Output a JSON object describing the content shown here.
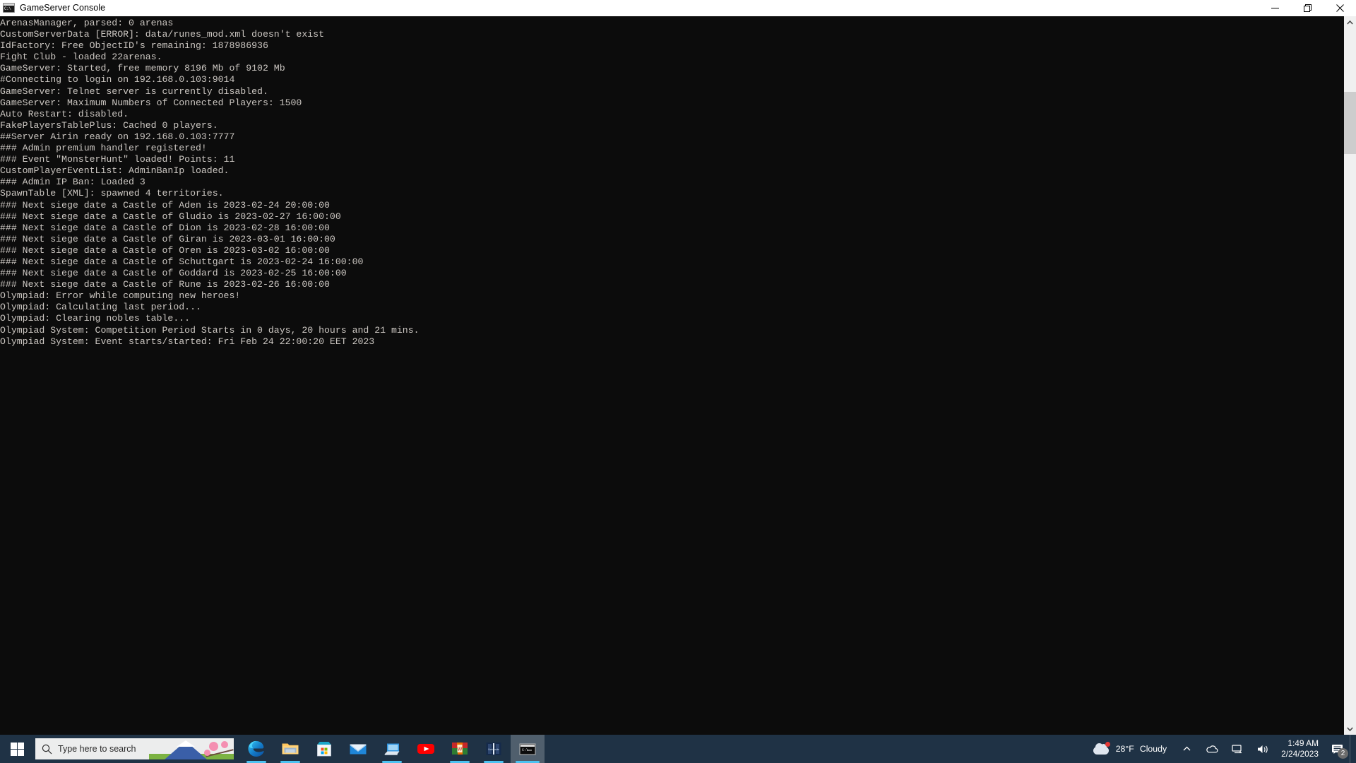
{
  "window": {
    "title": "GameServer Console",
    "icon": "console-icon",
    "controls": {
      "minimize_label": "Minimize",
      "restore_label": "Restore",
      "close_label": "Close"
    }
  },
  "console": {
    "foreground_color": "#ccc7c2",
    "background_color": "#0c0c0c",
    "lines": [
      "ArenasManager, parsed: 0 arenas",
      "CustomServerData [ERROR]: data/runes_mod.xml doesn't exist",
      "IdFactory: Free ObjectID's remaining: 1878986936",
      "Fight Club - loaded 22arenas.",
      "GameServer: Started, free memory 8196 Mb of 9102 Mb",
      "#Connecting to login on 192.168.0.103:9014",
      "GameServer: Telnet server is currently disabled.",
      "GameServer: Maximum Numbers of Connected Players: 1500",
      "Auto Restart: disabled.",
      "FakePlayersTablePlus: Cached 0 players.",
      "##Server Airin ready on 192.168.0.103:7777",
      "### Admin premium handler registered!",
      "### Event \"MonsterHunt\" loaded! Points: 11",
      "CustomPlayerEventList: AdminBanIp loaded.",
      "### Admin IP Ban: Loaded 3",
      "SpawnTable [XML]: spawned 4 territories.",
      "### Next siege date a Castle of Aden is 2023-02-24 20:00:00",
      "### Next siege date a Castle of Gludio is 2023-02-27 16:00:00",
      "### Next siege date a Castle of Dion is 2023-02-28 16:00:00",
      "### Next siege date a Castle of Giran is 2023-03-01 16:00:00",
      "### Next siege date a Castle of Oren is 2023-03-02 16:00:00",
      "### Next siege date a Castle of Schuttgart is 2023-02-24 16:00:00",
      "### Next siege date a Castle of Goddard is 2023-02-25 16:00:00",
      "### Next siege date a Castle of Rune is 2023-02-26 16:00:00",
      "Olympiad: Error while computing new heroes!",
      "Olympiad: Calculating last period...",
      "Olympiad: Clearing nobles table...",
      "Olympiad System: Competition Period Starts in 0 days, 20 hours and 21 mins.",
      "Olympiad System: Event starts/started: Fri Feb 24 22:00:20 EET 2023"
    ]
  },
  "scrollbar": {
    "up_arrow": "chevron-up-icon",
    "down_arrow": "chevron-down-icon"
  },
  "taskbar": {
    "background_color": "#1f3245",
    "start": {
      "label": "Start",
      "icon": "windows-logo-icon"
    },
    "search": {
      "placeholder": "Type here to search",
      "icon": "search-icon"
    },
    "apps": [
      {
        "name": "microsoft-edge",
        "label": "Microsoft Edge",
        "running": true,
        "active": false
      },
      {
        "name": "file-explorer",
        "label": "File Explorer",
        "running": true,
        "active": false
      },
      {
        "name": "microsoft-store",
        "label": "Microsoft Store",
        "running": false,
        "active": false
      },
      {
        "name": "mail",
        "label": "Mail",
        "running": false,
        "active": false
      },
      {
        "name": "remote-desktop",
        "label": "Remote Desktop",
        "running": true,
        "active": false
      },
      {
        "name": "youtube",
        "label": "YouTube",
        "running": false,
        "active": false
      },
      {
        "name": "winrar",
        "label": "WinRAR",
        "running": true,
        "active": false
      },
      {
        "name": "unicode-app",
        "label": "UniCode",
        "running": true,
        "active": false
      },
      {
        "name": "gameserver-console",
        "label": "GameServer Console",
        "running": true,
        "active": true
      }
    ],
    "tray": {
      "weather": {
        "temperature": "28°F",
        "condition": "Cloudy",
        "icon": "cloud-icon"
      },
      "show_hidden_icons": "chevron-up-icon",
      "icons": [
        {
          "name": "onedrive-icon",
          "label": "OneDrive"
        },
        {
          "name": "network-icon",
          "label": "Network"
        },
        {
          "name": "volume-icon",
          "label": "Volume"
        }
      ],
      "clock": {
        "time": "1:49 AM",
        "date": "2/24/2023"
      },
      "action_center": {
        "icon": "notification-icon",
        "badge": "2"
      }
    }
  }
}
